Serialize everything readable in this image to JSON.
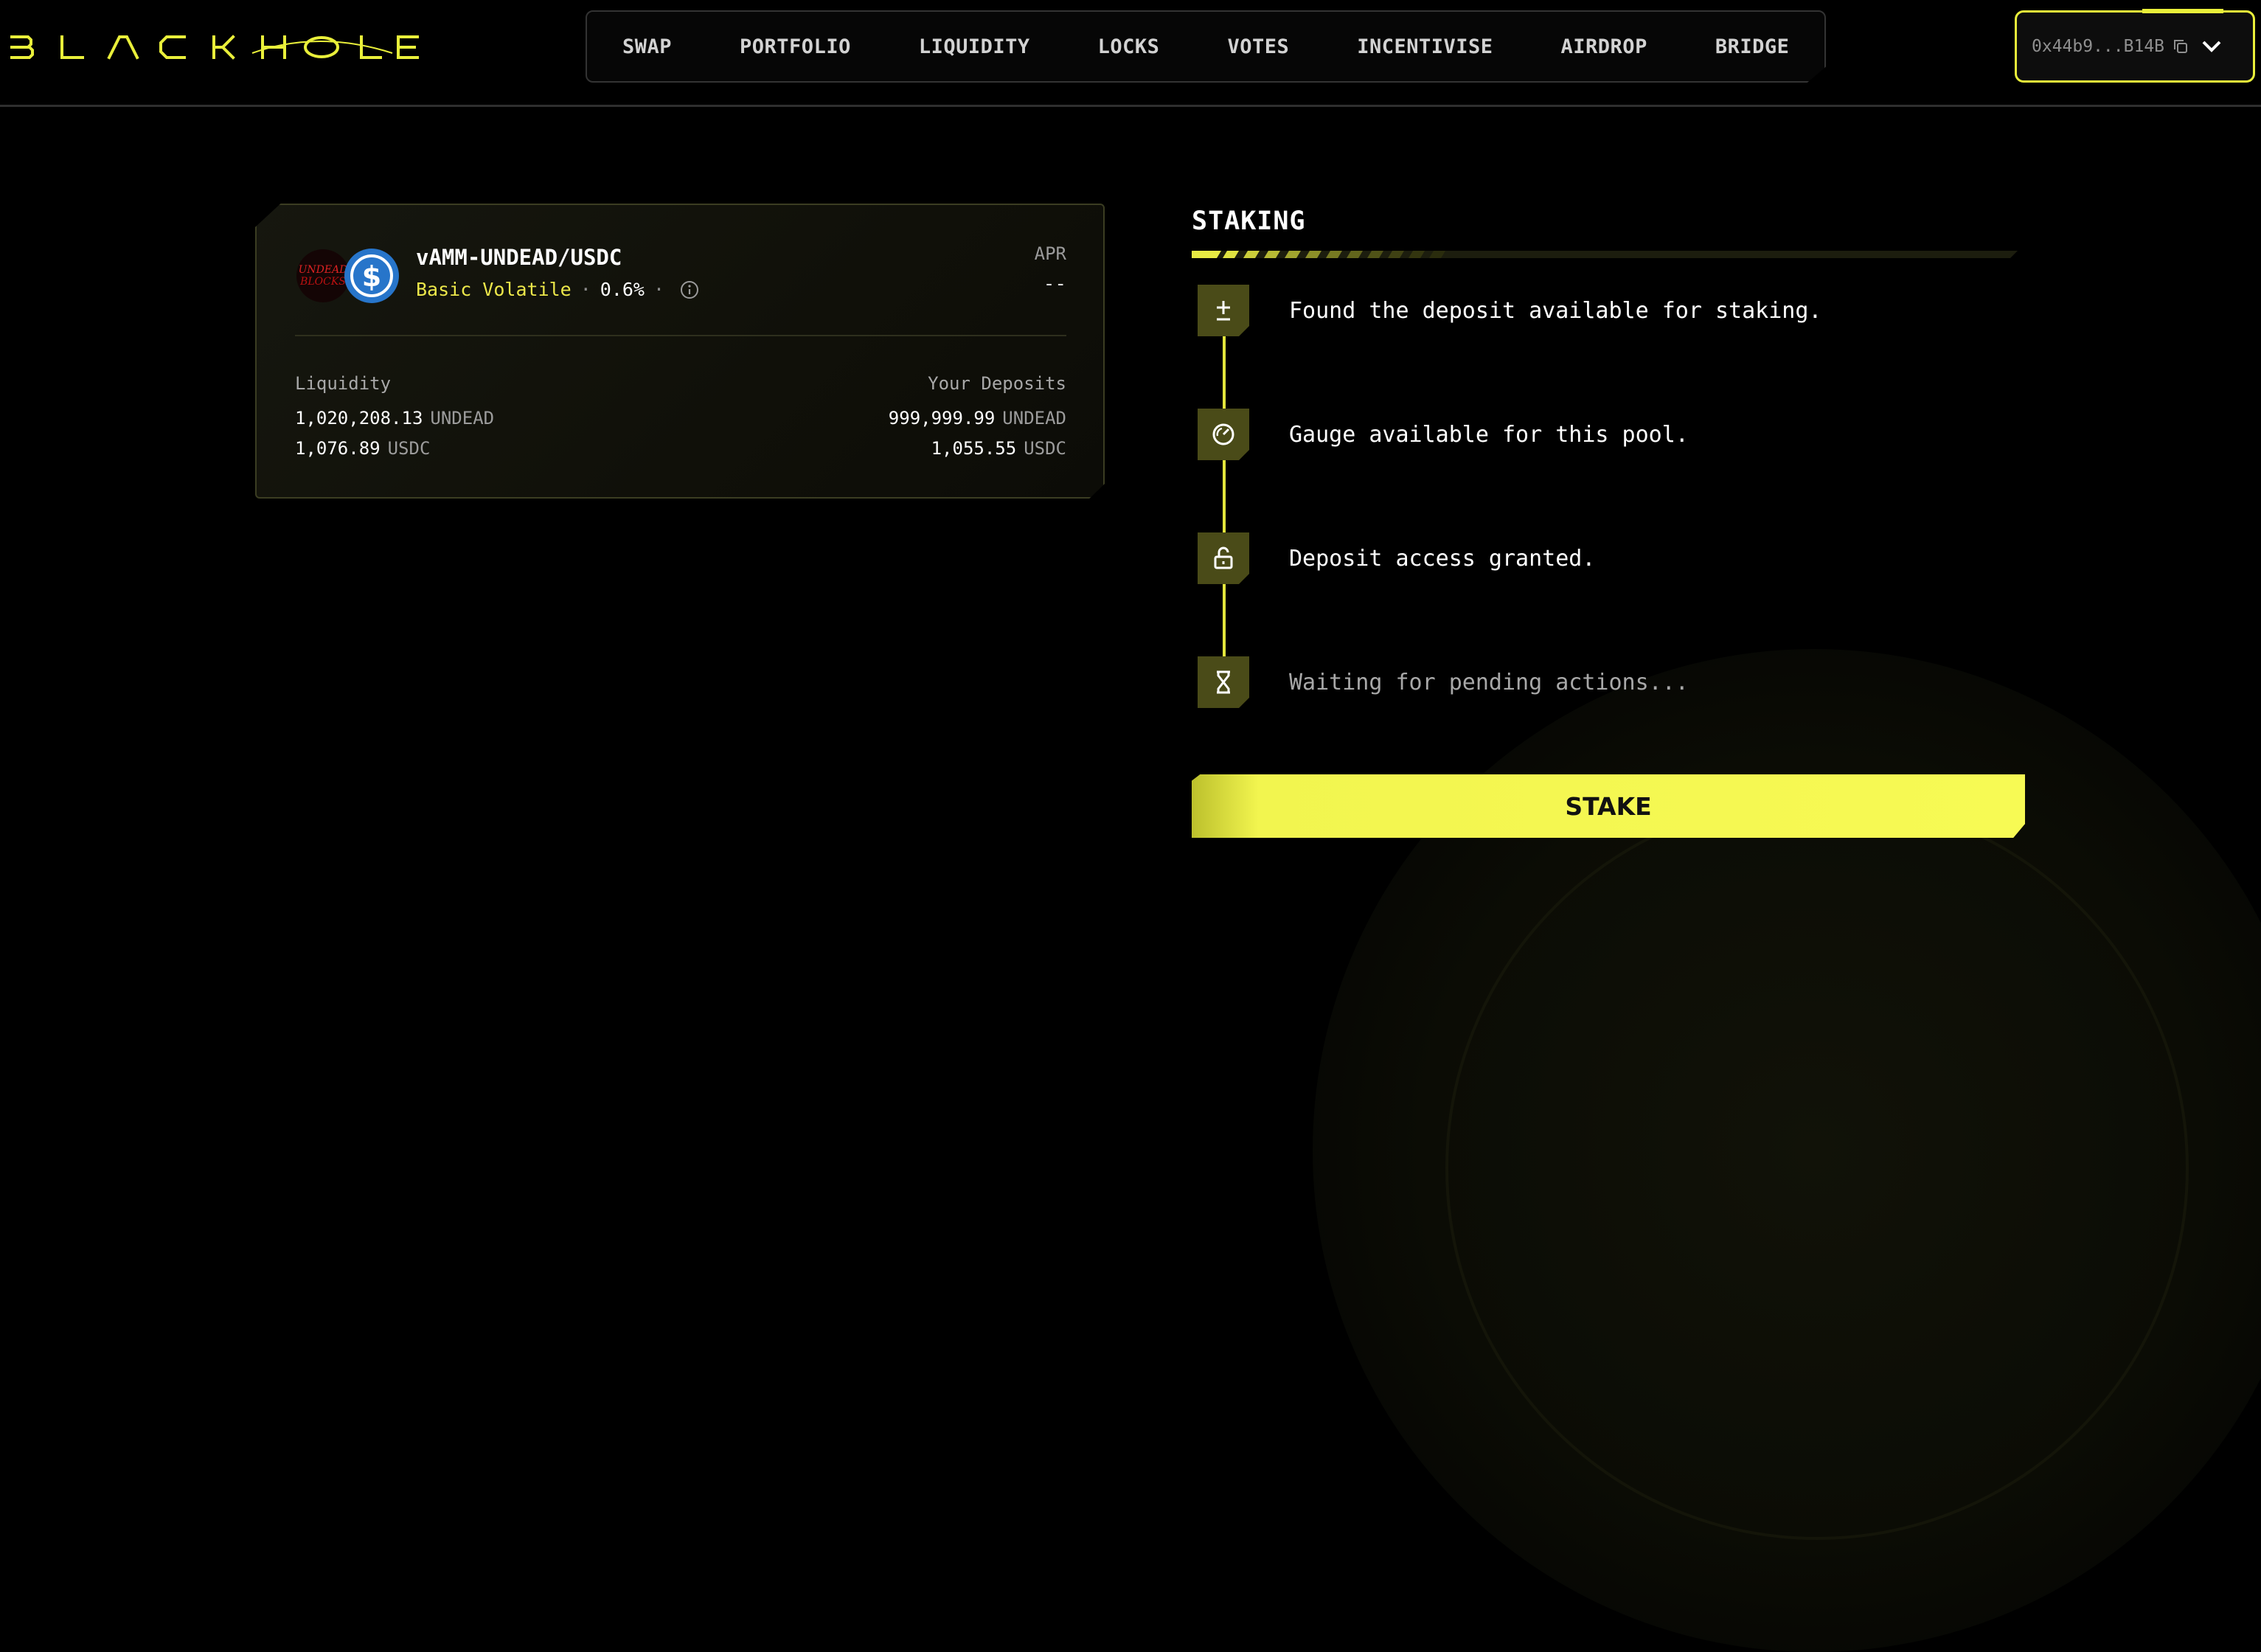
{
  "app": {
    "logo_text": "BLACKHOLE",
    "accent_color": "#f2f54f"
  },
  "nav": {
    "items": [
      "SWAP",
      "PORTFOLIO",
      "LIQUIDITY",
      "LOCKS",
      "VOTES",
      "INCENTIVISE",
      "AIRDROP",
      "BRIDGE"
    ]
  },
  "wallet": {
    "address": "0x44b9...B14B",
    "copy_icon": "copy-icon",
    "menu_icon": "chevron-down-icon"
  },
  "pool": {
    "pair_name": "vAMM-UNDEAD/USDC",
    "type": "Basic Volatile",
    "fee": "0.6%",
    "apr_label": "APR",
    "apr_value": "--",
    "liquidity_label": "Liquidity",
    "deposits_label": "Your Deposits",
    "liquidity": [
      {
        "amount": "1,020,208.13",
        "symbol": "UNDEAD"
      },
      {
        "amount": "1,076.89",
        "symbol": "USDC"
      }
    ],
    "deposits": [
      {
        "amount": "999,999.99",
        "symbol": "UNDEAD"
      },
      {
        "amount": "1,055.55",
        "symbol": "USDC"
      }
    ],
    "token_icons": [
      "undead-token-icon",
      "usdc-token-icon"
    ]
  },
  "staking": {
    "title": "STAKING",
    "steps": [
      {
        "icon": "plus-minus-icon",
        "text": "Found the deposit available for staking.",
        "status": "done"
      },
      {
        "icon": "gauge-icon",
        "text": "Gauge available for this pool.",
        "status": "done"
      },
      {
        "icon": "unlock-icon",
        "text": "Deposit access granted.",
        "status": "done"
      },
      {
        "icon": "hourglass-icon",
        "text": "Waiting for pending actions...",
        "status": "pending"
      }
    ],
    "button_label": "STAKE"
  }
}
